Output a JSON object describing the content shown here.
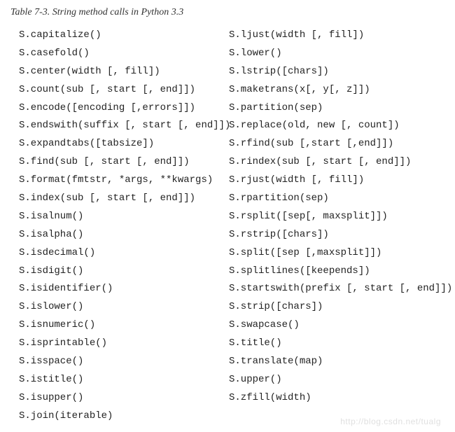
{
  "caption": "Table 7-3. String method calls in Python 3.3",
  "columns": {
    "left": [
      "S.capitalize()",
      "S.casefold()",
      "S.center(width [, fill])",
      "S.count(sub [, start [, end]])",
      "S.encode([encoding [,errors]])",
      "S.endswith(suffix [, start [, end]])",
      "S.expandtabs([tabsize])",
      "S.find(sub [, start [, end]])",
      "S.format(fmtstr, *args, **kwargs)",
      "S.index(sub [, start [, end]])",
      "S.isalnum()",
      "S.isalpha()",
      "S.isdecimal()",
      "S.isdigit()",
      "S.isidentifier()",
      "S.islower()",
      "S.isnumeric()",
      "S.isprintable()",
      "S.isspace()",
      "S.istitle()",
      "S.isupper()",
      "S.join(iterable)"
    ],
    "right": [
      "S.ljust(width [, fill])",
      "S.lower()",
      "S.lstrip([chars])",
      "S.maketrans(x[, y[, z]])",
      "S.partition(sep)",
      "S.replace(old, new [, count])",
      "S.rfind(sub [,start [,end]])",
      "S.rindex(sub [, start [, end]])",
      "S.rjust(width [, fill])",
      "S.rpartition(sep)",
      "S.rsplit([sep[, maxsplit]])",
      "S.rstrip([chars])",
      "S.split([sep [,maxsplit]])",
      "S.splitlines([keepends])",
      "S.startswith(prefix [, start [, end]])",
      "S.strip([chars])",
      "S.swapcase()",
      "S.title()",
      "S.translate(map)",
      "S.upper()",
      "S.zfill(width)"
    ]
  },
  "watermark": "http://blog.csdn.net/tualg"
}
